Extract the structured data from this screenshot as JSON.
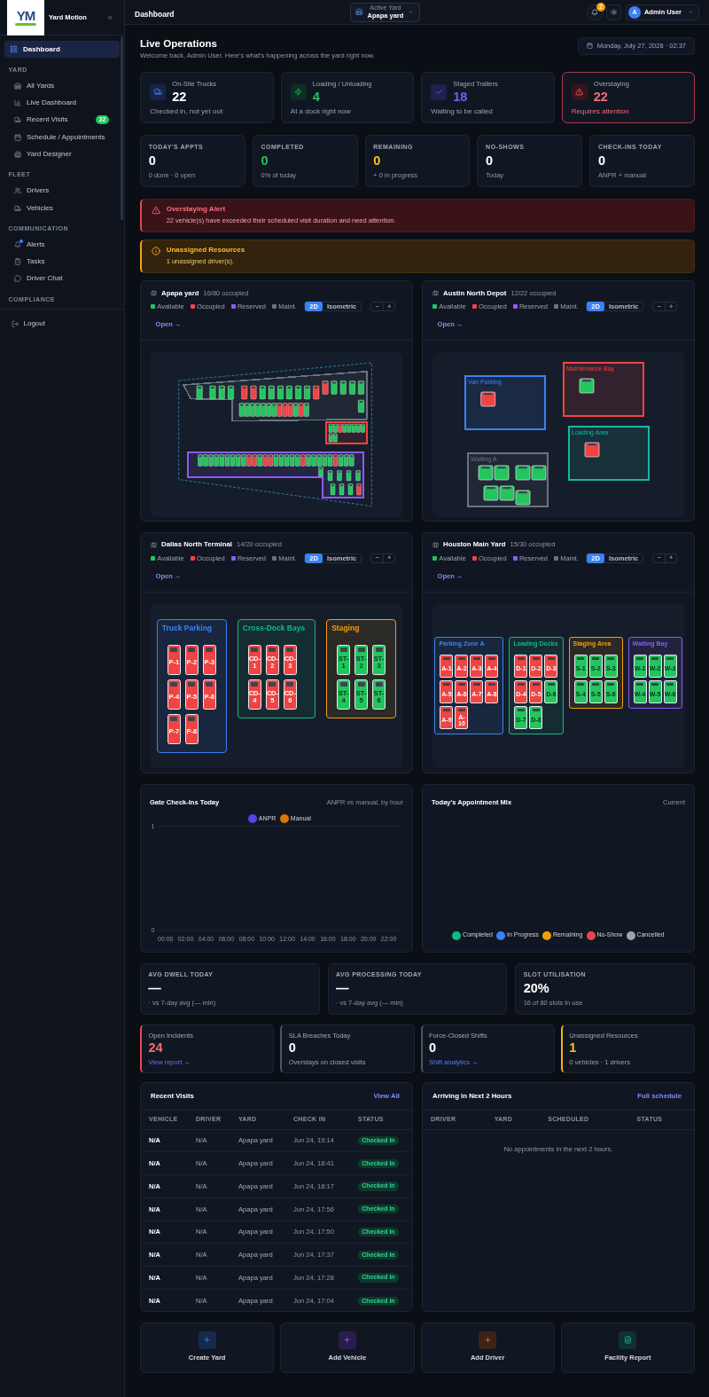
{
  "sidebar": {
    "brand": {
      "logo_text": "YM",
      "name": "Yard Motion"
    },
    "items": [
      {
        "label": "Dashboard",
        "selected": true
      }
    ],
    "sections": [
      {
        "title": "YARD",
        "items": [
          {
            "label": "All Yards",
            "selected": false
          },
          {
            "label": "Live Dashboard",
            "selected": false
          },
          {
            "label": "Recent Visits",
            "selected": false,
            "badge": "22"
          },
          {
            "label": "Schedule / Appointments",
            "selected": false
          },
          {
            "label": "Yard Designer",
            "selected": false
          }
        ]
      },
      {
        "title": "FLEET",
        "items": [
          {
            "label": "Drivers",
            "selected": false
          },
          {
            "label": "Vehicles",
            "selected": false
          }
        ]
      },
      {
        "title": "COMMUNICATION",
        "items": [
          {
            "label": "Alerts",
            "selected": false,
            "unread": true
          },
          {
            "label": "Tasks",
            "selected": false,
            "unread": false
          },
          {
            "label": "Driver Chat",
            "selected": false,
            "unread": false
          }
        ]
      },
      {
        "title": "COMPLIANCE"
      }
    ],
    "logout": "Logout"
  },
  "header": {
    "title": "Dashboard",
    "active_yard": {
      "label": "Active Yard",
      "value": "Apapa yard"
    },
    "notification_count": "2",
    "user": {
      "initial": "A",
      "name": "Admin User"
    }
  },
  "page": {
    "title": "Live Operations",
    "subtitle": "Welcome back, Admin User. Here's what's happening across the yard right now.",
    "date": "Monday, July 27, 2026 · 02:37"
  },
  "kpis": [
    {
      "kind": "info",
      "label": "On-Site Trucks",
      "value": "22",
      "caption": "Checked in, not yet out"
    },
    {
      "kind": "success",
      "label": "Loading / Unloading",
      "value": "4",
      "caption": "At a dock right now"
    },
    {
      "kind": "accent",
      "label": "Staged Trailers",
      "value": "18",
      "caption": "Waiting to be called"
    },
    {
      "kind": "danger",
      "label": "Overstaying",
      "value": "22",
      "caption": "Requires attention"
    }
  ],
  "stats": [
    {
      "kind": "neutral",
      "label": "TODAY'S APPTS",
      "value": "0",
      "caption": "0 done · 0 open"
    },
    {
      "kind": "success",
      "label": "COMPLETED",
      "value": "0",
      "caption": "0% of today"
    },
    {
      "kind": "warning",
      "label": "REMAINING",
      "value": "0",
      "caption": "+ 0 in progress"
    },
    {
      "kind": "neutral",
      "label": "NO-SHOWS",
      "value": "0",
      "caption": "Today"
    },
    {
      "kind": "neutral",
      "label": "CHECK-INS TODAY",
      "value": "0",
      "caption": "ANPR + manual"
    }
  ],
  "alerts": [
    {
      "kind": "danger",
      "title": "Overstaying Alert",
      "message": "22 vehicle(s) have exceeded their scheduled visit duration and need attention."
    },
    {
      "kind": "warning",
      "title": "Unassigned Resources",
      "message": "1 unassigned driver(s)."
    }
  ],
  "yards": [
    {
      "name": "Apapa yard",
      "occupancy": "16/80 occupied",
      "legend": [
        {
          "label": "Available",
          "color": "#22c55e"
        },
        {
          "label": "Occupied",
          "color": "#ef4444"
        },
        {
          "label": "Reserved",
          "color": "#8b5cf6"
        },
        {
          "label": "Maint.",
          "color": "#6b7280"
        }
      ],
      "view_modes": [
        {
          "label": "2D",
          "selected": true
        },
        {
          "label": "Isometric",
          "selected": false
        }
      ],
      "zoom_controls": [
        "−",
        "+"
      ],
      "open_link": "Open →",
      "map": {
        "kind": "plan",
        "zones": [
          {
            "color": "#6b7280",
            "slots": [
              {
                "occupied": false
              },
              {
                "occupied": false
              },
              {
                "occupied": false
              },
              {
                "occupied": false
              },
              {
                "occupied": true
              },
              {
                "occupied": true
              },
              {
                "occupied": false
              },
              {
                "occupied": false
              },
              {
                "occupied": false
              },
              {
                "occupied": false
              },
              {
                "occupied": false
              },
              {
                "occupied": false
              },
              {
                "occupied": true
              },
              {
                "occupied": true
              },
              {
                "occupied": false
              },
              {
                "occupied": false
              },
              {
                "occupied": false
              },
              {
                "occupied": false
              },
              {
                "occupied": false
              },
              {
                "occupied": false
              },
              {
                "occupied": false
              },
              {
                "occupied": false
              },
              {
                "occupied": false
              },
              {
                "occupied": false
              },
              {
                "occupied": false
              },
              {
                "occupied": false
              },
              {
                "occupied": true
              },
              {
                "occupied": true
              },
              {
                "occupied": true
              },
              {
                "occupied": false
              },
              {
                "occupied": true
              },
              {
                "occupied": false
              }
            ]
          },
          {
            "color": "#ef4444",
            "slots": [
              {
                "occupied": false
              },
              {
                "occupied": false
              },
              {
                "occupied": true
              },
              {
                "occupied": false
              },
              {
                "occupied": false
              },
              {
                "occupied": false
              },
              {
                "occupied": false
              },
              {
                "occupied": false
              },
              {
                "occupied": false
              },
              {
                "occupied": false
              }
            ]
          },
          {
            "color": "#8b5cf6",
            "slots": [
              {
                "occupied": false
              },
              {
                "occupied": false
              },
              {
                "occupied": false
              },
              {
                "occupied": false
              },
              {
                "occupied": false
              },
              {
                "occupied": false
              },
              {
                "occupied": false
              },
              {
                "occupied": false
              },
              {
                "occupied": false
              },
              {
                "occupied": true
              },
              {
                "occupied": true
              },
              {
                "occupied": false
              },
              {
                "occupied": true
              },
              {
                "occupied": true
              },
              {
                "occupied": false
              },
              {
                "occupied": false
              },
              {
                "occupied": false
              },
              {
                "occupied": false
              },
              {
                "occupied": false
              },
              {
                "occupied": true
              },
              {
                "occupied": false
              },
              {
                "occupied": false
              },
              {
                "occupied": false
              },
              {
                "occupied": false
              },
              {
                "occupied": false
              },
              {
                "occupied": true
              },
              {
                "occupied": false
              },
              {
                "occupied": false
              },
              {
                "occupied": false
              },
              {
                "occupied": false
              },
              {
                "occupied": false
              },
              {
                "occupied": false
              },
              {
                "occupied": false
              },
              {
                "occupied": false
              },
              {
                "occupied": false
              },
              {
                "occupied": false
              },
              {
                "occupied": false
              },
              {
                "occupied": true
              }
            ]
          }
        ]
      }
    },
    {
      "name": "Austin North Depot",
      "occupancy": "12/22 occupied",
      "legend": [
        {
          "label": "Available",
          "color": "#22c55e"
        },
        {
          "label": "Occupied",
          "color": "#ef4444"
        },
        {
          "label": "Reserved",
          "color": "#8b5cf6"
        },
        {
          "label": "Maint.",
          "color": "#6b7280"
        }
      ],
      "view_modes": [
        {
          "label": "2D",
          "selected": true
        },
        {
          "label": "Isometric",
          "selected": false
        }
      ],
      "zoom_controls": [
        "−",
        "+"
      ],
      "open_link": "Open →",
      "map": {
        "kind": "plan",
        "zones": [
          {
            "label": "Van Parking",
            "color": "#3b82f6",
            "slots": [
              {
                "occupied": true
              }
            ]
          },
          {
            "label": "Maintenance Bay",
            "color": "#ef4444",
            "slots": [
              {
                "occupied": false
              }
            ]
          },
          {
            "label": "Loading Area",
            "color": "#14b8a6",
            "slots": [
              {
                "occupied": true
              }
            ]
          },
          {
            "label": "Waiting A",
            "color": "#6b7280",
            "slots": [
              {
                "occupied": false
              },
              {
                "occupied": false
              },
              {
                "occupied": false
              },
              {
                "occupied": false
              },
              {
                "occupied": false
              },
              {
                "occupied": false
              },
              {
                "occupied": false
              }
            ]
          }
        ]
      }
    },
    {
      "name": "Dallas North Terminal",
      "occupancy": "14/20 occupied",
      "legend": [
        {
          "label": "Available",
          "color": "#22c55e"
        },
        {
          "label": "Occupied",
          "color": "#ef4444"
        },
        {
          "label": "Reserved",
          "color": "#8b5cf6"
        },
        {
          "label": "Maint.",
          "color": "#6b7280"
        }
      ],
      "view_modes": [
        {
          "label": "2D",
          "selected": true
        },
        {
          "label": "Isometric",
          "selected": false
        }
      ],
      "zoom_controls": [
        "−",
        "+"
      ],
      "open_link": "Open →",
      "map": {
        "kind": "grid",
        "zones": [
          {
            "label": "Truck Parking",
            "color": "#3b82f6",
            "slots": [
              {
                "label": "P-1",
                "occupied": true
              },
              {
                "label": "P-2",
                "occupied": true
              },
              {
                "label": "P-3",
                "occupied": true
              },
              {
                "label": "P-4",
                "occupied": true
              },
              {
                "label": "P-5",
                "occupied": true
              },
              {
                "label": "P-6",
                "occupied": true
              },
              {
                "label": "P-7",
                "occupied": true
              },
              {
                "label": "P-8",
                "occupied": true
              }
            ]
          },
          {
            "label": "Cross-Dock Bays",
            "color": "#10b981",
            "slots": [
              {
                "label": "CD-1",
                "occupied": true
              },
              {
                "label": "CD-2",
                "occupied": true
              },
              {
                "label": "CD-3",
                "occupied": true
              },
              {
                "label": "CD-4",
                "occupied": true
              },
              {
                "label": "CD-5",
                "occupied": true
              },
              {
                "label": "CD-6",
                "occupied": true
              }
            ]
          },
          {
            "label": "Staging",
            "color": "#f59e0b",
            "slots": [
              {
                "label": "ST-1",
                "occupied": false
              },
              {
                "label": "ST-2",
                "occupied": false
              },
              {
                "label": "ST-3",
                "occupied": false
              },
              {
                "label": "ST-4",
                "occupied": false
              },
              {
                "label": "ST-5",
                "occupied": false
              },
              {
                "label": "ST-6",
                "occupied": false
              }
            ]
          }
        ]
      }
    },
    {
      "name": "Houston Main Yard",
      "occupancy": "15/30 occupied",
      "legend": [
        {
          "label": "Available",
          "color": "#22c55e"
        },
        {
          "label": "Occupied",
          "color": "#ef4444"
        },
        {
          "label": "Reserved",
          "color": "#8b5cf6"
        },
        {
          "label": "Maint.",
          "color": "#6b7280"
        }
      ],
      "view_modes": [
        {
          "label": "2D",
          "selected": true
        },
        {
          "label": "Isometric",
          "selected": false
        }
      ],
      "zoom_controls": [
        "−",
        "+"
      ],
      "open_link": "Open →",
      "map": {
        "kind": "grid",
        "zones": [
          {
            "label": "Parking Zone A",
            "color": "#3b82f6",
            "slots": [
              {
                "label": "A-1",
                "occupied": true
              },
              {
                "label": "A-2",
                "occupied": true
              },
              {
                "label": "A-3",
                "occupied": true
              },
              {
                "label": "A-4",
                "occupied": true
              },
              {
                "label": "A-5",
                "occupied": true
              },
              {
                "label": "A-6",
                "occupied": true
              },
              {
                "label": "A-7",
                "occupied": true
              },
              {
                "label": "A-8",
                "occupied": true
              },
              {
                "label": "A-9",
                "occupied": true
              },
              {
                "label": "A-10",
                "occupied": true
              }
            ]
          },
          {
            "label": "Loading Docks",
            "color": "#10b981",
            "slots": [
              {
                "label": "D-1",
                "occupied": true
              },
              {
                "label": "D-2",
                "occupied": true
              },
              {
                "label": "D-3",
                "occupied": true
              },
              {
                "label": "D-4",
                "occupied": true
              },
              {
                "label": "D-5",
                "occupied": true
              },
              {
                "label": "D-6",
                "occupied": false
              },
              {
                "label": "D-7",
                "occupied": false
              },
              {
                "label": "D-8",
                "occupied": false
              }
            ]
          },
          {
            "label": "Staging Area",
            "color": "#f59e0b",
            "slots": [
              {
                "label": "S-1",
                "occupied": false
              },
              {
                "label": "S-2",
                "occupied": false
              },
              {
                "label": "S-3",
                "occupied": false
              },
              {
                "label": "S-4",
                "occupied": false
              },
              {
                "label": "S-5",
                "occupied": false
              },
              {
                "label": "S-6",
                "occupied": false
              }
            ]
          },
          {
            "label": "Waiting Bay",
            "color": "#8b5cf6",
            "slots": [
              {
                "label": "W-1",
                "occupied": false
              },
              {
                "label": "W-2",
                "occupied": false
              },
              {
                "label": "W-3",
                "occupied": false
              },
              {
                "label": "W-4",
                "occupied": false
              },
              {
                "label": "W-5",
                "occupied": false
              },
              {
                "label": "W-6",
                "occupied": false
              }
            ]
          }
        ]
      }
    }
  ],
  "charts": [
    {
      "title": "Gate Check-Ins Today",
      "subtitle": "ANPR vs manual, by hour",
      "chart_data": {
        "type": "line",
        "categories": [
          "00:00",
          "02:00",
          "04:00",
          "06:00",
          "08:00",
          "10:00",
          "12:00",
          "14:00",
          "16:00",
          "18:00",
          "20:00",
          "22:00"
        ],
        "ylim": [
          0,
          1
        ],
        "yticks": [
          {
            "value": 0,
            "label": "0"
          },
          {
            "value": 1,
            "label": "1"
          }
        ],
        "series": [
          {
            "name": "ANPR",
            "color": "#4f46e5",
            "values": [
              null,
              null,
              null,
              null,
              null,
              null,
              null,
              null,
              null,
              null,
              null,
              null
            ]
          },
          {
            "name": "Manual",
            "color": "#d97706",
            "values": [
              null,
              null,
              null,
              null,
              null,
              null,
              null,
              null,
              null,
              null,
              null,
              null
            ]
          }
        ]
      }
    },
    {
      "title": "Today's Appointment Mix",
      "subtitle": "Current",
      "legend": [
        {
          "label": "Completed",
          "color": "#10b981"
        },
        {
          "label": "In Progress",
          "color": "#3b82f6"
        },
        {
          "label": "Remaining",
          "color": "#f59e0b"
        },
        {
          "label": "No-Show",
          "color": "#ef4444"
        },
        {
          "label": "Cancelled",
          "color": "#9ca3af"
        }
      ]
    }
  ],
  "metrics": [
    {
      "label": "AVG DWELL TODAY",
      "value": "—",
      "caption": "· vs 7-day avg (— min)"
    },
    {
      "label": "AVG PROCESSING TODAY",
      "value": "—",
      "caption": "· vs 7-day avg (— min)"
    },
    {
      "label": "SLOT UTILISATION",
      "value": "20%",
      "caption": "16 of 80 slots in use"
    }
  ],
  "summary": [
    {
      "kind": "danger",
      "label": "Open Incidents",
      "value": "24",
      "link": "View report →"
    },
    {
      "kind": "neutral",
      "label": "SLA Breaches Today",
      "value": "0",
      "caption": "Overstays on closed visits"
    },
    {
      "kind": "neutral",
      "label": "Force-Closed Shifts",
      "value": "0",
      "link": "Shift analytics →"
    },
    {
      "kind": "warning",
      "label": "Unassigned Resources",
      "value": "1",
      "caption": "0 vehicles · 1 drivers"
    }
  ],
  "recent_visits": {
    "title": "Recent Visits",
    "action": "View All",
    "columns": [
      "VEHICLE",
      "DRIVER",
      "YARD",
      "CHECK IN",
      "STATUS"
    ],
    "rows": [
      {
        "vehicle": "N/A",
        "driver": "N/A",
        "yard": "Apapa yard",
        "check_in": "Jun 24, 19:14",
        "status": "Checked In"
      },
      {
        "vehicle": "N/A",
        "driver": "N/A",
        "yard": "Apapa yard",
        "check_in": "Jun 24, 18:41",
        "status": "Checked In"
      },
      {
        "vehicle": "N/A",
        "driver": "N/A",
        "yard": "Apapa yard",
        "check_in": "Jun 24, 18:17",
        "status": "Checked In"
      },
      {
        "vehicle": "N/A",
        "driver": "N/A",
        "yard": "Apapa yard",
        "check_in": "Jun 24, 17:56",
        "status": "Checked In"
      },
      {
        "vehicle": "N/A",
        "driver": "N/A",
        "yard": "Apapa yard",
        "check_in": "Jun 24, 17:50",
        "status": "Checked In"
      },
      {
        "vehicle": "N/A",
        "driver": "N/A",
        "yard": "Apapa yard",
        "check_in": "Jun 24, 17:37",
        "status": "Checked In"
      },
      {
        "vehicle": "N/A",
        "driver": "N/A",
        "yard": "Apapa yard",
        "check_in": "Jun 24, 17:28",
        "status": "Checked In"
      },
      {
        "vehicle": "N/A",
        "driver": "N/A",
        "yard": "Apapa yard",
        "check_in": "Jun 24, 17:04",
        "status": "Checked In"
      }
    ]
  },
  "arrivals": {
    "title": "Arriving in Next 2 Hours",
    "action": "Full schedule",
    "columns": [
      "DRIVER",
      "YARD",
      "SCHEDULED",
      "STATUS"
    ],
    "empty_message": "No appointments in the next 2 hours."
  },
  "quick_actions": [
    {
      "kind": "yard",
      "label": "Create Yard"
    },
    {
      "kind": "vehicle",
      "label": "Add Vehicle"
    },
    {
      "kind": "driver",
      "label": "Add Driver"
    },
    {
      "kind": "report",
      "label": "Facility Report"
    }
  ]
}
